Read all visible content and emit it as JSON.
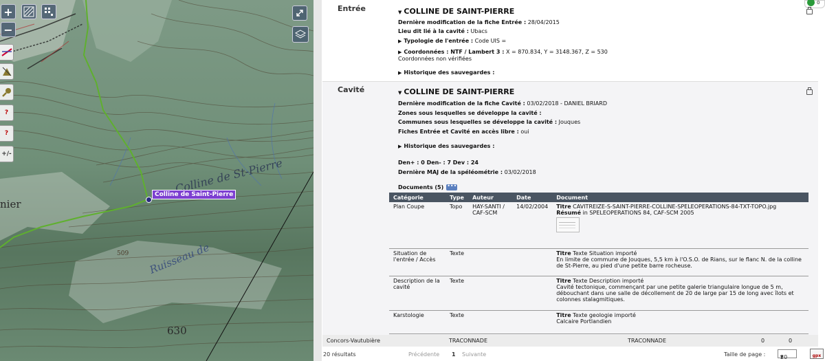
{
  "map": {
    "zoom_in": "+",
    "zoom_out": "−",
    "place_label": "Colline de Saint-Pierre",
    "map_texts": [
      "Colline de St-Pierre",
      "Ruisseau de",
      "630",
      "509",
      "nier"
    ],
    "tools": [
      "?",
      "?",
      "+/-"
    ],
    "icons": [
      "zoom-in-icon",
      "zoom-out-icon",
      "fullscreen-icon",
      "layers-icon",
      "grid-icon"
    ]
  },
  "entree": {
    "section_label": "Entrée",
    "title": "COLLINE DE SAINT-PIERRE",
    "last_mod_label": "Dernière modification de la fiche Entrée :",
    "last_mod_value": "28/04/2015",
    "lieu_label": "Lieu dit lié à la cavité :",
    "lieu_value": "Ubacs",
    "typologie_label": "Typologie de l'entrée :",
    "typologie_value": "Code UIS =",
    "coords_label": "Coordonnées : NTF / Lambert 3 :",
    "coords_value": "X = 870.834, Y = 3148.367, Z = 530",
    "coords_note": "Coordonnées non vérifiées",
    "historique": "Historique des sauvegardes :"
  },
  "cavite": {
    "section_label": "Cavité",
    "title": "COLLINE DE SAINT-PIERRE",
    "last_mod_label": "Dernière modification de la fiche Cavité :",
    "last_mod_value": "03/02/2018 - DANIEL BRIARD",
    "zones_label": "Zones sous lesquelles se développe la cavité :",
    "communes_label": "Communes sous lesquelles se développe la cavité :",
    "communes_value": "Jouques",
    "fiches_label": "Fiches Entrée et Cavité en accès libre :",
    "fiches_value": "oui",
    "historique": "Historique des sauvegardes :",
    "den_line": "Den+ : 0 Den- : 7 Dev : 24",
    "maj_label": "Dernière MAJ de la spéléométrie :",
    "maj_value": "03/02/2018",
    "documents_label": "Documents (5)",
    "documents_btn": "•••"
  },
  "docs_table": {
    "headers": [
      "Catégorie",
      "Type",
      "Auteur",
      "Date",
      "Document"
    ],
    "rows": [
      {
        "categorie": "Plan Coupe",
        "type": "Topo",
        "auteur": "HAY-SANTI / CAF-SCM",
        "date": "14/02/2004",
        "doc_line1_label": "Titre",
        "doc_line1": "CAVITREIZE-S-SAINT-PIERRE-COLLINE-SPELEOPERATIONS-84-TXT-TOPO.jpg",
        "doc_line2_label": "Résumé",
        "doc_line2": "in SPELEOPERATIONS 84, CAF-SCM 2005"
      },
      {
        "categorie": "Situation de l'entrée / Accès",
        "type": "Texte",
        "auteur": "",
        "date": "",
        "doc_line1_label": "Titre",
        "doc_line1": "Texte Situation importé",
        "doc_line2_label": "",
        "doc_line2": "En limite de commune de Jouques, 5,5 km à l'O.S.O. de Rians, sur le flanc N. de la colline de St-Pierre, au pied d'une petite barre rocheuse."
      },
      {
        "categorie": "Description de la cavité",
        "type": "Texte",
        "auteur": "",
        "date": "",
        "doc_line1_label": "Titre",
        "doc_line1": "Texte Description importé",
        "doc_line2_label": "",
        "doc_line2": "Cavité tectonique, commençant par une petite galerie triangulaire longue de 5 m, débouchant dans une salle de décollement de 20 de large par 15 de long avec îlots et colonnes stalagmitiques."
      },
      {
        "categorie": "Karstologie",
        "type": "Texte",
        "auteur": "",
        "date": "",
        "doc_line1_label": "Titre",
        "doc_line1": "Texte geologie importé",
        "doc_line2_label": "",
        "doc_line2": "Calcaire Portlandien"
      }
    ]
  },
  "footer_row": {
    "name": "Concors-Vautubière",
    "col2": "TRACONNADE",
    "col3": "TRACONNADE",
    "col4": "0",
    "col5": "0"
  },
  "pager": {
    "results": "20 résultats",
    "prev": "Précédente",
    "page": "1",
    "next": "Suivante",
    "page_size_label": "Taille de page :",
    "page_size_value": "20",
    "gpx": "gpx"
  },
  "widget": {
    "count": "0"
  },
  "colors": {
    "label_purple": "#7d3fd1",
    "header_dark": "#4a5562",
    "trail_green": "#5fb02e"
  }
}
